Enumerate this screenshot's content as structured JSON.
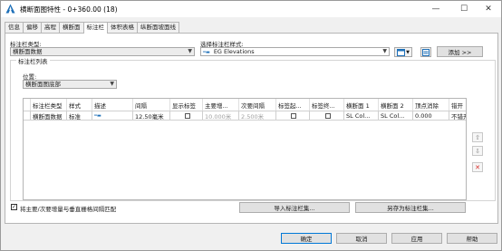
{
  "window": {
    "title": "横断面图特性 - 0+360.00 (18)",
    "minimize": "—",
    "maximize": "☐",
    "close": "✕"
  },
  "tabs": [
    {
      "label": "信息"
    },
    {
      "label": "偏移"
    },
    {
      "label": "高程"
    },
    {
      "label": "横断面"
    },
    {
      "label": "标注栏"
    },
    {
      "label": "体积表格"
    },
    {
      "label": "纵断面坡面线"
    }
  ],
  "band_type": {
    "label": "标注栏类型:",
    "value": "横断面数据"
  },
  "band_style": {
    "label": "选择标注栏样式:",
    "value": "EG Elevations",
    "add_button": "添加 >>"
  },
  "band_list": {
    "title": "标注栏列表",
    "position_label": "位置:",
    "position_value": "横断面图底部"
  },
  "grid": {
    "columns": [
      "标注栏类型",
      "样式",
      "描述",
      "间隔",
      "显示标签",
      "主要增...",
      "次要间隔",
      "标签起...",
      "标签终...",
      "横断面 1",
      "横断面 2",
      "顶点消除",
      "错开"
    ],
    "row": {
      "type": "横断面数据",
      "style": "标准",
      "description": "",
      "gap": "12.50毫米",
      "show_labels": false,
      "major_increment": "10.000米",
      "minor_interval": "2.500米",
      "label_start": false,
      "label_end": false,
      "section1": "SL Col...",
      "section2": "SL Col...",
      "vertex_weed": "0.000",
      "stagger": "不错开"
    }
  },
  "side_buttons": {
    "up": "⇧",
    "down": "⇩",
    "delete": "✕"
  },
  "bottom": {
    "match_checkbox_label": "将主要/次要增量与垂直栅格间隔匹配",
    "match_checked": true,
    "import_button": "导入标注栏集...",
    "save_button": "另存为标注栏集..."
  },
  "footer": {
    "ok": "确定",
    "cancel": "取消",
    "apply": "应用",
    "help": "帮助"
  },
  "colors": {
    "accent": "#0078d7",
    "delete_red": "#d9302c",
    "disabled_text": "#a0a0a0"
  }
}
